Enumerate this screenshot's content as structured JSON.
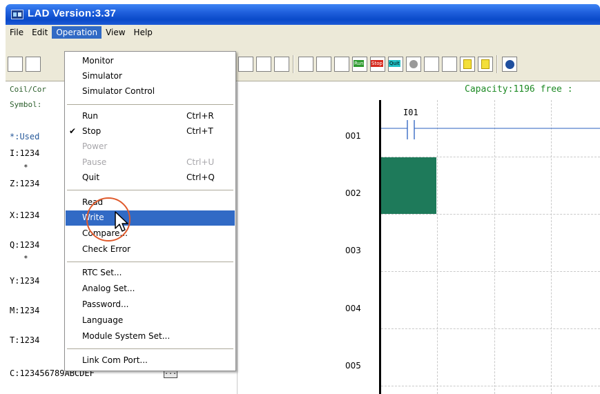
{
  "window": {
    "title": "LAD Version:3.37"
  },
  "menubar": [
    "File",
    "Edit",
    "Operation",
    "View",
    "Help"
  ],
  "toolbar_icons": [
    "rung-icon",
    "open-icon",
    "ladder-icon",
    "element-icon",
    "box-icon",
    "refresh-icon",
    "cycle-icon",
    "tools-icon",
    "run-icon",
    "stop-icon",
    "quit-icon",
    "circle-icon",
    "probe-icon",
    "pointer-icon",
    "page-icon",
    "page-back-icon",
    "help-icon"
  ],
  "run_label": "Run",
  "stop_label": "Stop",
  "quit_label": "Quit",
  "left_panel": {
    "coil_label": "Coil/Cor",
    "symbol_label": "Symbol:",
    "used_label": "*:Used",
    "rows": [
      "I:1234",
      "Z:1234",
      "X:1234",
      "Q:1234",
      "Y:1234",
      "M:1234",
      "T:1234",
      "C:123456789ABCDEF"
    ],
    "star": "*",
    "more_label": "..."
  },
  "ladder": {
    "capacity_text": "Capacity:1196 free :",
    "rung_numbers": [
      "001",
      "002",
      "003",
      "004",
      "005"
    ],
    "contact_label": "I01"
  },
  "dropdown": {
    "groups": [
      [
        {
          "label": "Monitor"
        },
        {
          "label": "Simulator"
        },
        {
          "label": "Simulator Control"
        }
      ],
      [
        {
          "label": "Run",
          "shortcut": "Ctrl+R"
        },
        {
          "label": "Stop",
          "shortcut": "Ctrl+T",
          "checked": true
        },
        {
          "label": "Power",
          "disabled": true
        },
        {
          "label": "Pause",
          "shortcut": "Ctrl+U",
          "disabled": true
        },
        {
          "label": "Quit",
          "shortcut": "Ctrl+Q"
        }
      ],
      [
        {
          "label": "Read"
        },
        {
          "label": "Write",
          "highlighted": true
        },
        {
          "label": "Compare..."
        },
        {
          "label": "Check Error"
        }
      ],
      [
        {
          "label": "RTC Set..."
        },
        {
          "label": "Analog Set..."
        },
        {
          "label": "Password..."
        },
        {
          "label": "Language"
        },
        {
          "label": "Module System Set..."
        }
      ],
      [
        {
          "label": "Link Com Port..."
        }
      ]
    ],
    "check_mark": "✔"
  },
  "colors": {
    "title_bar": "#0a4ac9",
    "menu_highlight": "#316ac5",
    "selection_cell": "#1e7a5a",
    "capacity_text": "#1d8a24",
    "callout_circle": "#e05a2c"
  }
}
